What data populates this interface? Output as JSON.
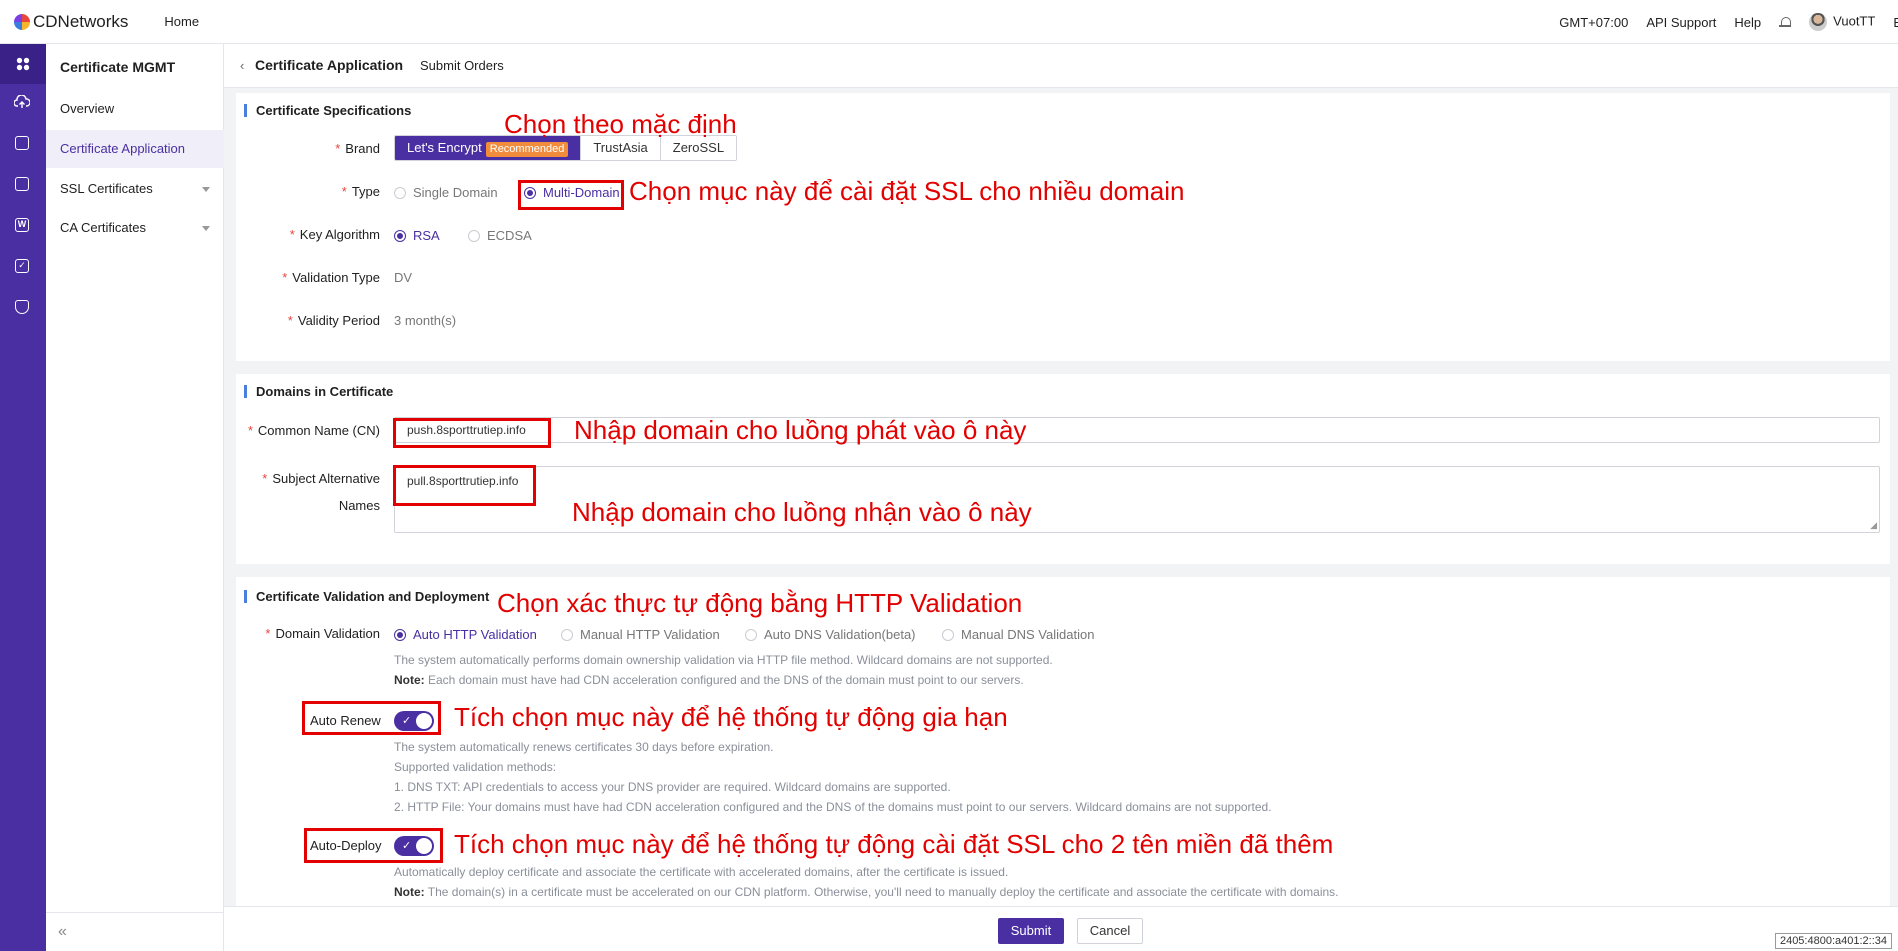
{
  "header": {
    "brand": "CDNetworks",
    "home": "Home",
    "timezone": "GMT+07:00",
    "api_support": "API Support",
    "help": "Help",
    "user": "VuotTT",
    "overflow": "E"
  },
  "sidebar": {
    "title": "Certificate MGMT",
    "items": [
      {
        "label": "Overview"
      },
      {
        "label": "Certificate Application"
      },
      {
        "label": "SSL Certificates"
      },
      {
        "label": "CA Certificates"
      }
    ],
    "collapse": "«"
  },
  "breadcrumb": {
    "back": "‹",
    "title": "Certificate Application",
    "sub": "Submit Orders"
  },
  "spec": {
    "title": "Certificate Specifications",
    "brand_label": "Brand",
    "brands": [
      "Let's Encrypt",
      "TrustAsia",
      "ZeroSSL"
    ],
    "recommended": "Recommended",
    "type_label": "Type",
    "type_options": [
      "Single Domain",
      "Multi-Domain"
    ],
    "algo_label": "Key Algorithm",
    "algo_options": [
      "RSA",
      "ECDSA"
    ],
    "validation_type_label": "Validation Type",
    "validation_type_value": "DV",
    "validity_label": "Validity Period",
    "validity_value": "3 month(s)"
  },
  "domains": {
    "title": "Domains in Certificate",
    "cn_label": "Common Name (CN)",
    "cn_value": "push.8sporttrutiep.info",
    "san_label_1": "Subject Alternative",
    "san_label_2": "Names",
    "san_value": "pull.8sporttrutiep.info"
  },
  "validation": {
    "title": "Certificate Validation and Deployment",
    "domain_validation_label": "Domain Validation",
    "options": [
      "Auto HTTP Validation",
      "Manual HTTP Validation",
      "Auto DNS Validation(beta)",
      "Manual DNS Validation"
    ],
    "help1": "The system automatically performs domain ownership validation via HTTP file method. Wildcard domains are not supported.",
    "note_label": "Note:",
    "help2": " Each domain must have had CDN acceleration configured and the DNS of the domain must point to our servers.",
    "auto_renew_label": "Auto Renew",
    "renew_help1": "The system automatically renews certificates 30 days before expiration.",
    "renew_help2": "Supported validation methods:",
    "renew_help3": "1. DNS TXT: API credentials to access your DNS provider are required. Wildcard domains are supported.",
    "renew_help4": "2. HTTP File: Your domains must have had CDN acceleration configured and the DNS of the domains must point to our servers. Wildcard domains are not supported.",
    "auto_deploy_label": "Auto-Deploy",
    "deploy_help1": "Automatically deploy certificate and associate the certificate with accelerated domains, after the certificate is issued.",
    "deploy_note": " The domain(s) in a certificate must be accelerated on our CDN platform. Otherwise, you'll need to manually deploy the certificate and associate the certificate with domains."
  },
  "annotations": {
    "a1": "Chọn theo mặc định",
    "a2": "Chọn mục này để cài đặt SSL cho nhiều domain",
    "a3": "Nhập domain cho luồng phát vào ô này",
    "a4": "Nhập domain cho luồng nhận vào ô này",
    "a5": "Chọn xác thực tự động bằng HTTP Validation",
    "a6": "Tích chọn mục này để hệ thống tự động gia hạn",
    "a7": "Tích chọn mục này để hệ thống tự động cài đặt SSL cho 2 tên miền đã thêm"
  },
  "footer": {
    "submit": "Submit",
    "cancel": "Cancel",
    "ip": "2405:4800:a401:2::34"
  },
  "colors": {
    "primary": "#4a2fa3",
    "annotation": "#e20000",
    "required": "#e8453c",
    "badge": "#f08c3c"
  }
}
